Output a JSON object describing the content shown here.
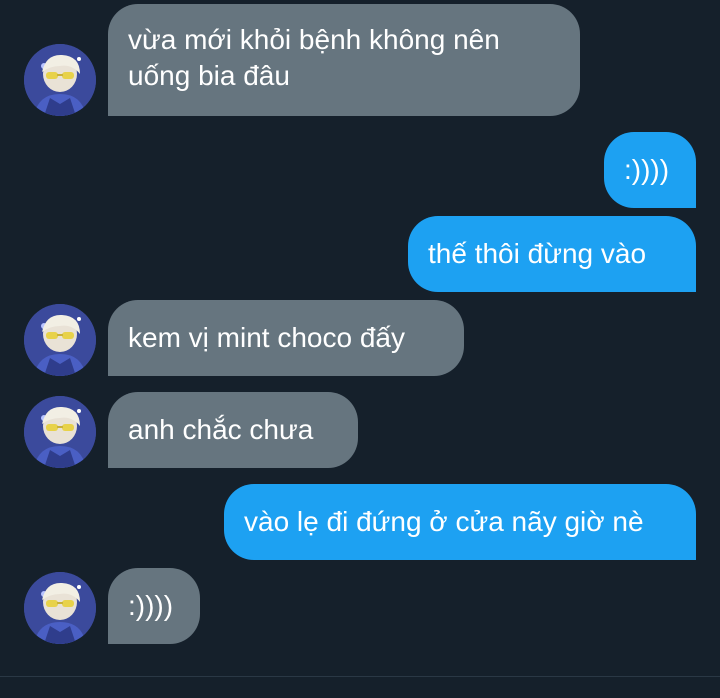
{
  "conversation": {
    "messages": [
      {
        "direction": "incoming",
        "text": "vừa mới khỏi bệnh không nên\nuống bia đâu"
      },
      {
        "direction": "outgoing",
        "text": ":))))"
      },
      {
        "direction": "outgoing",
        "text": "thế thôi đừng vào"
      },
      {
        "direction": "incoming",
        "text": "kem vị mint choco đấy"
      },
      {
        "direction": "incoming",
        "text": "anh chắc chưa"
      },
      {
        "direction": "outgoing",
        "text": "vào lẹ đi đứng ở cửa nãy giờ nè"
      },
      {
        "direction": "incoming",
        "text": ":))))"
      }
    ]
  },
  "theme": {
    "background": "#15202b",
    "incoming_bubble": "#66757f",
    "outgoing_bubble": "#1da1f2",
    "text": "#ffffff"
  },
  "icons": {
    "avatar": "contact-avatar-photo"
  }
}
